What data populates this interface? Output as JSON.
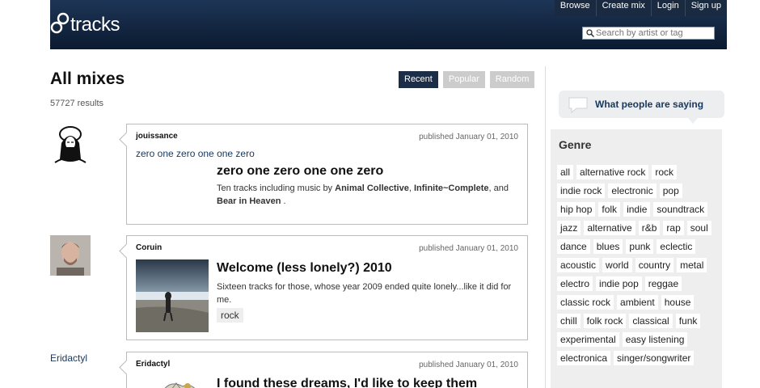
{
  "header": {
    "logo_text": "tracks",
    "nav": [
      "Browse",
      "Create mix",
      "Login",
      "Sign up"
    ],
    "search_placeholder": "Search by artist or tag"
  },
  "main": {
    "title": "All mixes",
    "results": "57727 results",
    "sort_tabs": [
      "Recent",
      "Popular",
      "Random"
    ],
    "active_sort": "Recent",
    "mixes": [
      {
        "user": "jouissance",
        "date": "published January 01, 2010",
        "link": "zero one zero one one zero",
        "title": "zero one zero one one zero",
        "desc_prefix": "Ten tracks including music by ",
        "artist1": "Animal Collective",
        "sep1": ", ",
        "artist2": "Infinite~Complete",
        "sep2": ", and ",
        "artist3": "Bear in Heaven",
        "desc_suffix": " ."
      },
      {
        "user": "Coruin",
        "date": "published January 01, 2010",
        "title": "Welcome (less lonely?) 2010",
        "desc": "Sixteen tracks for those, whose year 2009 ended quite lonely...like it did for me.",
        "tag": "rock"
      },
      {
        "user": "Eridactyl",
        "user_link": "Eridactyl",
        "date": "published January 01, 2010",
        "title": "I found these dreams, I'd like to keep them"
      }
    ]
  },
  "sidebar": {
    "people_saying": "What people are saying",
    "genre_title": "Genre",
    "genres": [
      "all",
      "alternative rock",
      "rock",
      "indie rock",
      "electronic",
      "pop",
      "hip hop",
      "folk",
      "indie",
      "soundtrack",
      "jazz",
      "alternative",
      "r&b",
      "rap",
      "soul",
      "dance",
      "blues",
      "punk",
      "eclectic",
      "acoustic",
      "world",
      "country",
      "metal",
      "electro",
      "indie pop",
      "reggae",
      "classic rock",
      "ambient",
      "house",
      "chill",
      "folk rock",
      "classical",
      "funk",
      "experimental",
      "easy listening",
      "electronica",
      "singer/songwriter"
    ]
  },
  "colors": {
    "header_bg": "#0b1a30",
    "link": "#17375e",
    "active_tab": "#1c2e47",
    "inactive_tab": "#cccccc"
  }
}
